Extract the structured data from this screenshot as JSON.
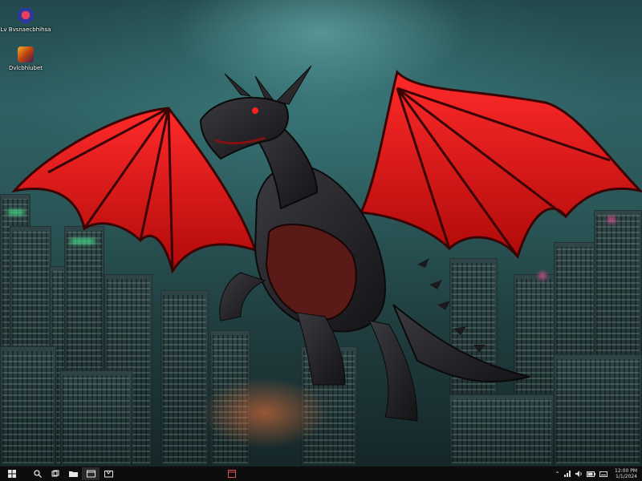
{
  "desktop": {
    "icons": [
      {
        "label": "Lv Bvsnaecbhihsa",
        "icon": "app-shield-icon"
      },
      {
        "label": "Dvlcbhlubet",
        "icon": "app-game-icon"
      }
    ]
  },
  "taskbar": {
    "start_icon": "start-icon",
    "pinned": [
      {
        "icon": "search-icon"
      },
      {
        "icon": "task-view-icon"
      },
      {
        "icon": "file-explorer-icon"
      },
      {
        "icon": "browser-icon"
      },
      {
        "icon": "store-icon"
      }
    ],
    "center_app_icon": "open-app-icon",
    "tray": {
      "icons": [
        "chevron-up-icon",
        "network-icon",
        "volume-icon",
        "battery-icon",
        "keyboard-icon"
      ],
      "time": "12:00 PM",
      "date": "1/1/2024"
    }
  },
  "colors": {
    "sky": "#2e6164",
    "wing": "#e01515",
    "taskbar": "#0d0d0d"
  }
}
